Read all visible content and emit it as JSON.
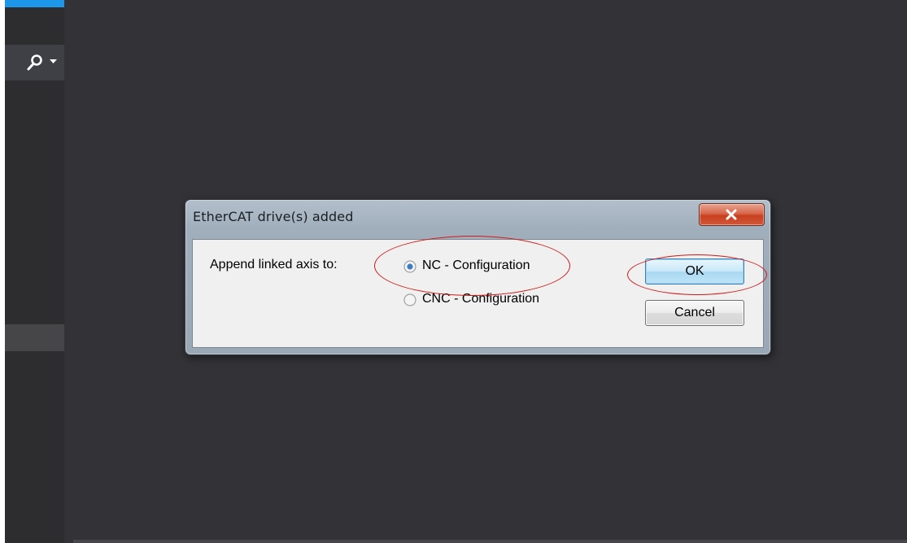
{
  "dialog": {
    "title": "EtherCAT drive(s) added",
    "prompt": "Append linked axis to:",
    "options": [
      {
        "label": "NC - Configuration",
        "selected": true
      },
      {
        "label": "CNC - Configuration",
        "selected": false
      }
    ],
    "ok_label": "OK",
    "cancel_label": "Cancel"
  },
  "colors": {
    "background": "#333337",
    "panel": "#2d2d30",
    "accent": "#1c97ea",
    "annotation": "#d01818"
  },
  "icons": [
    "search-icon",
    "dropdown-icon",
    "close-icon"
  ]
}
